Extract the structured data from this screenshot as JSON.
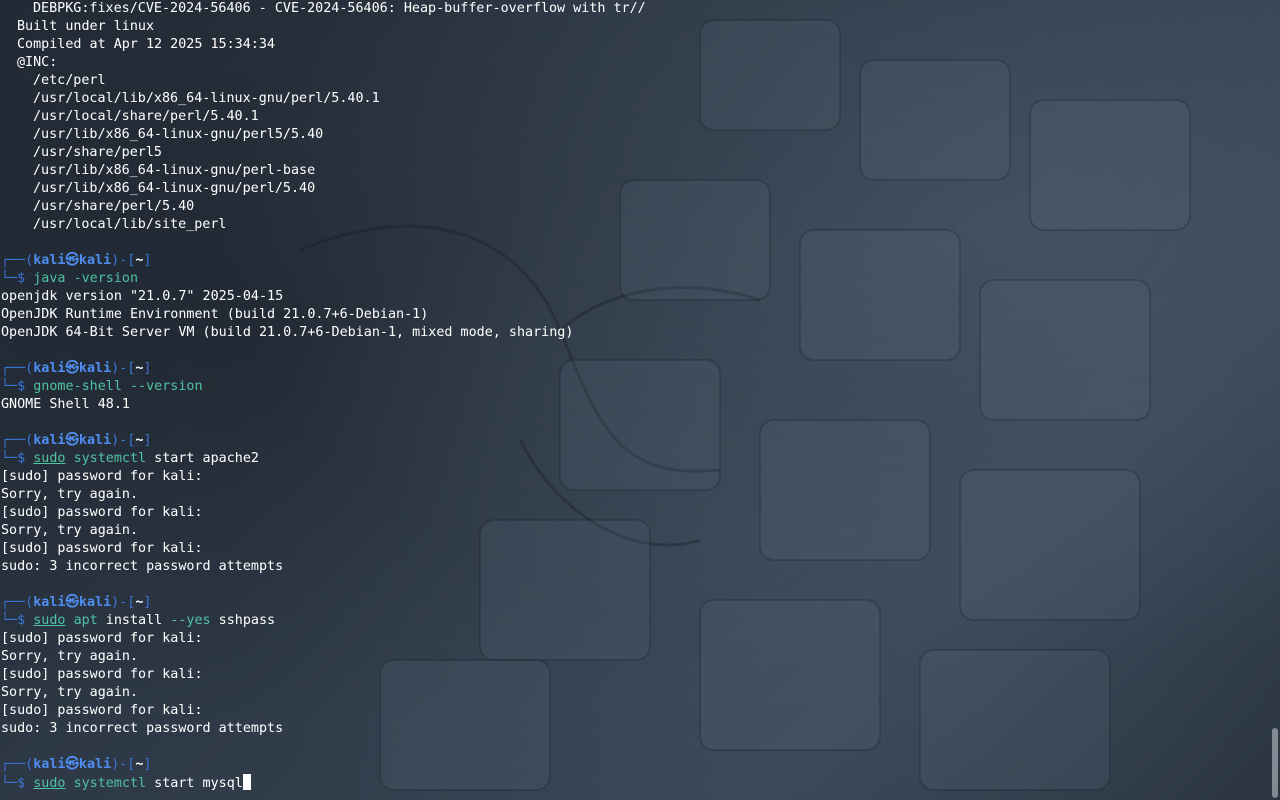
{
  "output_top": [
    {
      "text": "DEBPKG:fixes/CVE-2024-56406 - CVE-2024-56406: Heap-buffer-overflow with tr//",
      "indent": 2
    },
    {
      "text": "Built under linux",
      "indent": 1
    },
    {
      "text": "Compiled at Apr 12 2025 15:34:34",
      "indent": 1
    },
    {
      "text": "@INC:",
      "indent": 1
    },
    {
      "text": "/etc/perl",
      "indent": 2
    },
    {
      "text": "/usr/local/lib/x86_64-linux-gnu/perl/5.40.1",
      "indent": 2
    },
    {
      "text": "/usr/local/share/perl/5.40.1",
      "indent": 2
    },
    {
      "text": "/usr/lib/x86_64-linux-gnu/perl5/5.40",
      "indent": 2
    },
    {
      "text": "/usr/share/perl5",
      "indent": 2
    },
    {
      "text": "/usr/lib/x86_64-linux-gnu/perl-base",
      "indent": 2
    },
    {
      "text": "/usr/lib/x86_64-linux-gnu/perl/5.40",
      "indent": 2
    },
    {
      "text": "/usr/share/perl/5.40",
      "indent": 2
    },
    {
      "text": "/usr/local/lib/site_perl",
      "indent": 2
    }
  ],
  "prompt": {
    "corner_top": "┌──(",
    "user": "kali",
    "at": "㉿",
    "host": "kali",
    "sep": ")-[",
    "dir": "~",
    "end": "]",
    "corner_bottom": "└─",
    "dollar": "$ "
  },
  "blocks": [
    {
      "command": [
        {
          "text": "java",
          "style": "green"
        },
        {
          "text": " ",
          "style": "plain"
        },
        {
          "text": "-version",
          "style": "green"
        }
      ],
      "output": [
        "openjdk version \"21.0.7\" 2025-04-15",
        "OpenJDK Runtime Environment (build 21.0.7+6-Debian-1)",
        "OpenJDK 64-Bit Server VM (build 21.0.7+6-Debian-1, mixed mode, sharing)"
      ]
    },
    {
      "command": [
        {
          "text": "gnome-shell",
          "style": "green"
        },
        {
          "text": " ",
          "style": "plain"
        },
        {
          "text": "--version",
          "style": "green"
        }
      ],
      "output": [
        "GNOME Shell 48.1"
      ]
    },
    {
      "command": [
        {
          "text": "sudo",
          "style": "sudo"
        },
        {
          "text": " ",
          "style": "plain"
        },
        {
          "text": "systemctl",
          "style": "green"
        },
        {
          "text": " start apache2",
          "style": "plain"
        }
      ],
      "output": [
        "[sudo] password for kali:",
        "Sorry, try again.",
        "[sudo] password for kali:",
        "Sorry, try again.",
        "[sudo] password for kali:",
        "sudo: 3 incorrect password attempts"
      ]
    },
    {
      "command": [
        {
          "text": "sudo",
          "style": "sudo"
        },
        {
          "text": " ",
          "style": "plain"
        },
        {
          "text": "apt",
          "style": "green"
        },
        {
          "text": " install ",
          "style": "plain"
        },
        {
          "text": "--yes",
          "style": "green"
        },
        {
          "text": " sshpass",
          "style": "plain"
        }
      ],
      "output": [
        "[sudo] password for kali:",
        "Sorry, try again.",
        "[sudo] password for kali:",
        "Sorry, try again.",
        "[sudo] password for kali:",
        "sudo: 3 incorrect password attempts"
      ]
    },
    {
      "command": [
        {
          "text": "sudo",
          "style": "sudo"
        },
        {
          "text": " ",
          "style": "plain"
        },
        {
          "text": "systemctl",
          "style": "green"
        },
        {
          "text": " start mysql",
          "style": "plain"
        }
      ],
      "output": [],
      "current": true
    }
  ],
  "colors": {
    "prompt_frame": "#3b74d6",
    "prompt_user": "#4f8df0",
    "command_green": "#4ec2a5",
    "text": "#ffffff",
    "background": "#2a3340"
  }
}
